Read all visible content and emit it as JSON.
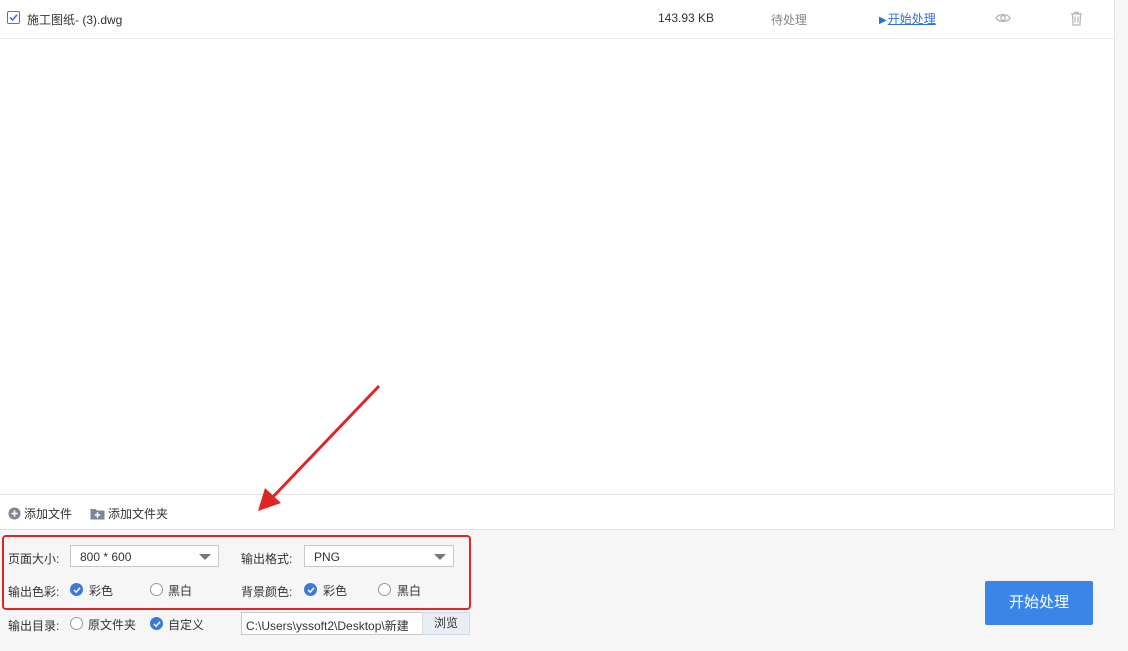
{
  "file_list": {
    "rows": [
      {
        "checked": true,
        "name": "施工图纸- (3).dwg",
        "size": "143.93 KB",
        "status": "待处理",
        "action_label": "开始处理",
        "preview_icon": "eye-icon",
        "delete_icon": "trash-icon"
      }
    ]
  },
  "add_bar": {
    "add_file_label": "添加文件",
    "add_folder_label": "添加文件夹"
  },
  "settings": {
    "page_size_label": "页面大小:",
    "page_size_value": "800 * 600",
    "output_format_label": "输出格式:",
    "output_format_value": "PNG",
    "output_color_label": "输出色彩:",
    "output_color_options": [
      "彩色",
      "黑白"
    ],
    "output_color_selected": "彩色",
    "bg_color_label": "背景颜色:",
    "bg_color_options": [
      "彩色",
      "黑白"
    ],
    "bg_color_selected": "彩色",
    "output_dir_label": "输出目录:",
    "output_dir_options": [
      "原文件夹",
      "自定义"
    ],
    "output_dir_selected": "自定义",
    "output_path": "C:\\Users\\yssoft2\\Desktop\\新建",
    "browse_label": "浏览"
  },
  "actions": {
    "process_label": "开始处理"
  },
  "colors": {
    "accent": "#3a86e8",
    "link": "#2f6fd6",
    "highlight_box": "#e02525"
  }
}
